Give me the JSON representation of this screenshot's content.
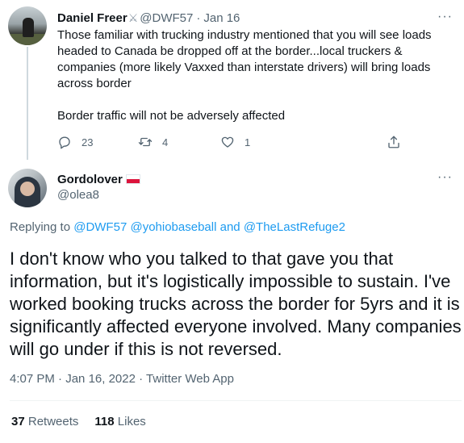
{
  "parent": {
    "name": "Daniel Freer",
    "name_badge_icon": "crossed-swords-icon",
    "handle": "@DWF57",
    "separator": "·",
    "date": "Jan 16",
    "more": "···",
    "text_p1": "Those familiar with trucking industry mentioned that you will see loads headed to Canada be dropped off at the border...local truckers & companies (more likely Vaxxed than interstate drivers) will bring loads across border",
    "text_p2": "Border traffic will not be adversely affected",
    "actions": {
      "reply_count": "23",
      "retweet_count": "4",
      "like_count": "1"
    }
  },
  "reply": {
    "name": "Gordolover",
    "name_badge_icon": "poland-flag-icon",
    "handle": "@olea8",
    "more": "···",
    "replying_prefix": "Replying to ",
    "replying_to_1": "@DWF57",
    "replying_to_2": "@yohiobaseball",
    "replying_and": " and ",
    "replying_to_3": "@TheLastRefuge2",
    "text": "I don't know who you talked to that gave you that information, but it's logistically impossible to sustain. I've worked booking trucks across the border for 5yrs and it is significantly affected everyone involved. Many companies will go under if this is not reversed.",
    "time": "4:07 PM",
    "date": "Jan 16, 2022",
    "separator": " · ",
    "source": "Twitter Web App",
    "retweets_count": "37",
    "retweets_label": "Retweets",
    "likes_count": "118",
    "likes_label": "Likes"
  },
  "colors": {
    "link": "#1d9bf0",
    "secondary_text": "#536471",
    "primary_text": "#0f1419"
  }
}
